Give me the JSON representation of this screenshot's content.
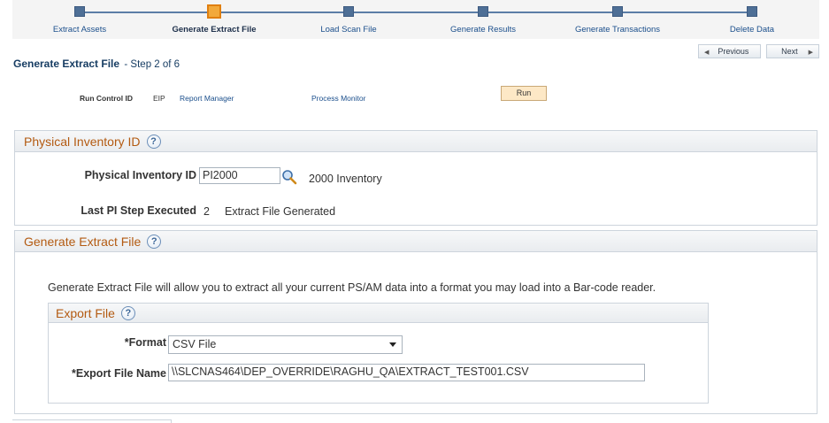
{
  "train": {
    "steps": [
      {
        "label": "Extract Assets",
        "active": false
      },
      {
        "label": "Generate Extract File",
        "active": true
      },
      {
        "label": "Load Scan File",
        "active": false
      },
      {
        "label": "Generate Results",
        "active": false
      },
      {
        "label": "Generate Transactions",
        "active": false
      },
      {
        "label": "Delete Data",
        "active": false
      }
    ]
  },
  "nav": {
    "previous_label": "Previous",
    "next_label": "Next"
  },
  "page": {
    "title": "Generate Extract File",
    "step": "- Step 2 of 6"
  },
  "run_control": {
    "label": "Run Control ID",
    "value": "EIP",
    "report_manager": "Report Manager",
    "process_monitor": "Process Monitor",
    "run_button": "Run"
  },
  "physical_inventory": {
    "group_title": "Physical Inventory ID",
    "help": "?",
    "id_label": "Physical Inventory ID",
    "id_value": "PI2000",
    "id_description": "2000 Inventory",
    "last_step_label": "Last PI Step Executed",
    "last_step_number": "2",
    "last_step_description": "Extract File Generated"
  },
  "generate_extract": {
    "group_title": "Generate Extract File",
    "help": "?",
    "description": "Generate Extract File will allow you to extract all your current PS/AM data into a format you may load into a Bar-code reader."
  },
  "export_file": {
    "group_title": "Export File",
    "help": "?",
    "format_label": "*Format",
    "format_value": "CSV File",
    "file_name_label": "*Export File Name",
    "file_name_value": "\\\\SLCNAS464\\DEP_OVERRIDE\\RAGHU_QA\\EXTRACT_TEST001.CSV"
  },
  "colors": {
    "accent_orange": "#b35a11",
    "link_blue": "#1b4f8c",
    "active_step": "#f2a93b"
  }
}
